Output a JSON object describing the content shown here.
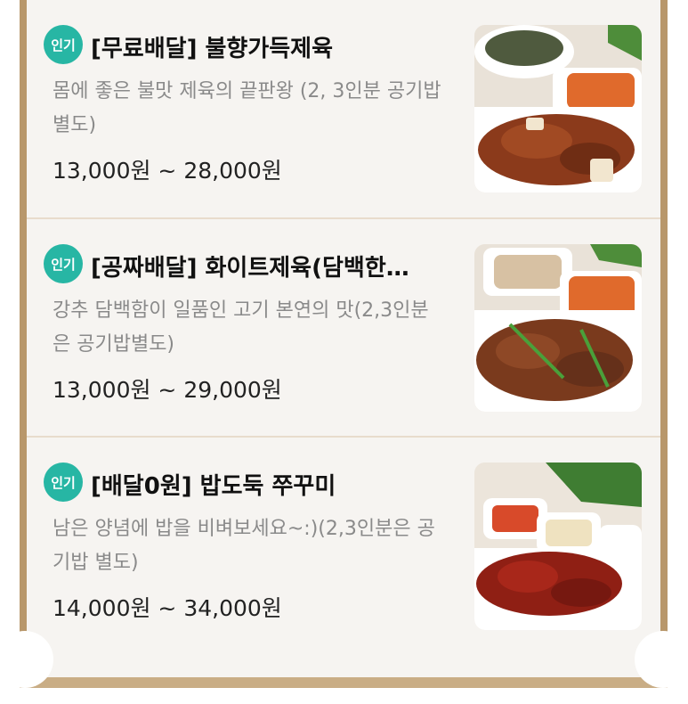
{
  "menu": {
    "items": [
      {
        "badge": "인기",
        "title": "[무료배달] 불향가득제육",
        "description": "몸에 좋은 불맛 제육의 끝판왕 (2, 3인분 공기밥 별도)",
        "price": "13,000원 ~ 28,000원",
        "image": "spicy-pork-dish-photo"
      },
      {
        "badge": "인기",
        "title": "[공짜배달] 화이트제육(담백한…",
        "description": "강추 담백함이 일품인 고기 본연의 맛(2,3인분은 공기밥별도)",
        "price": "13,000원 ~ 29,000원",
        "image": "white-pork-dish-photo"
      },
      {
        "badge": "인기",
        "title": "[배달0원] 밥도둑 쭈꾸미",
        "description": "남은 양념에 밥을 비벼보세요~:)(2,3인분은 공기밥 별도)",
        "price": "14,000원 ~ 34,000원",
        "image": "spicy-octopus-dish-photo"
      }
    ]
  },
  "colors": {
    "badge": "#27b6a4",
    "frame": "#b8976b",
    "panel": "#f6f4f1"
  }
}
